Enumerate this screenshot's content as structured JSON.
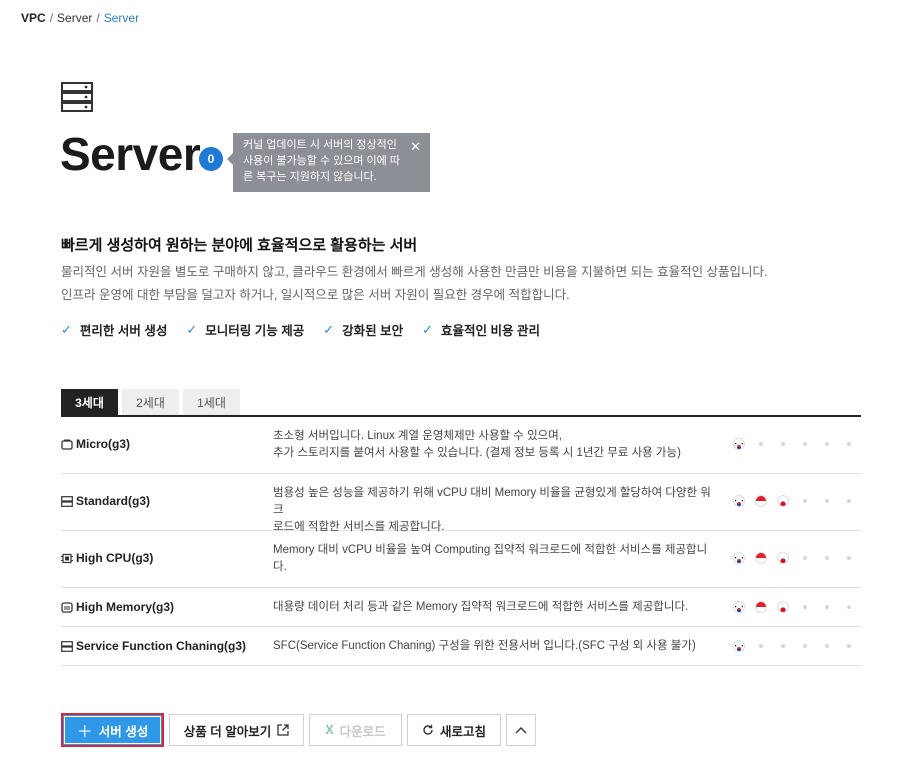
{
  "breadcrumb": {
    "root": "VPC",
    "parent": "Server",
    "current": "Server",
    "separator": "/"
  },
  "page": {
    "title": "Server",
    "badge": "0",
    "tooltip": "커널 업데이트 시 서버의 정상적인 사용이 불가능할 수 있으며 이에 따른 복구는 지원하지 않습니다.",
    "tooltip_close": "✕",
    "headline": "빠르게 생성하여 원하는 분야에 효율적으로 활용하는 서버",
    "desc_line1": "물리적인 서버 자원을 별도로 구매하지 않고, 클라우드 환경에서 빠르게 생성해 사용한 만큼만 비용을 지불하면 되는 효율적인 상품입니다.",
    "desc_line2": "인프라 운영에 대한 부담을 덜고자 하거나, 일시적으로 많은 서버 자원이 필요한 경우에 적합합니다."
  },
  "features": [
    "편리한 서버 생성",
    "모니터링 기능 제공",
    "강화된 보안",
    "효율적인 비용 관리"
  ],
  "tabs": [
    "3세대",
    "2세대",
    "1세대"
  ],
  "active_tab": "3세대",
  "products": [
    {
      "name": "Micro(g3)",
      "icon": "micro-server-icon",
      "desc1": "초소형 서버입니다. Linux 계열 운영체제만 사용할 수 있으며,",
      "desc2": "추가 스토리지를 붙여서 사용할 수 있습니다. (결제 정보 등록 시 1년간 무료 사용 가능)",
      "regions": [
        "kr",
        "-",
        "-",
        "-",
        "-",
        "-"
      ]
    },
    {
      "name": "Standard(g3)",
      "icon": "standard-server-icon",
      "desc1": "범용성 높은 성능을 제공하기 위해 vCPU 대비 Memory 비율을 균형있게 할당하여 다양한 워크",
      "desc2": "로드에 적합한 서비스를 제공합니다.",
      "regions": [
        "kr",
        "sg",
        "jp",
        "-",
        "-",
        "-"
      ]
    },
    {
      "name": "High CPU(g3)",
      "icon": "high-cpu-icon",
      "desc1": "Memory 대비 vCPU 비율을 높여 Computing 집약적 워크로드에 적합한 서비스를 제공합니",
      "desc2": "다.",
      "regions": [
        "kr",
        "sg",
        "jp",
        "-",
        "-",
        "-"
      ]
    },
    {
      "name": "High Memory(g3)",
      "icon": "high-memory-icon",
      "desc1": "대용량 데이터 처리 등과 같은 Memory 집약적 워크로드에 적합한 서비스를 제공합니다.",
      "desc2": "",
      "regions": [
        "kr",
        "sg",
        "jp",
        "-",
        "-",
        "-"
      ]
    },
    {
      "name": "Service Function Chaning(g3)",
      "icon": "sfc-server-icon",
      "desc1": "SFC(Service Function Chaning) 구성을 위한 전용서버 입니다.(SFC 구성 외 사용 불가)",
      "desc2": "",
      "regions": [
        "kr",
        "-",
        "-",
        "-",
        "-",
        "-"
      ]
    }
  ],
  "buttons": {
    "create": "서버 생성",
    "learn_more": "상품 더 알아보기",
    "download": "다운로드",
    "refresh": "새로고침"
  },
  "colors": {
    "accent": "#2f98e8",
    "badge": "#1f79d6",
    "highlight_border": "#e0232e",
    "link": "#2a7fd4"
  }
}
